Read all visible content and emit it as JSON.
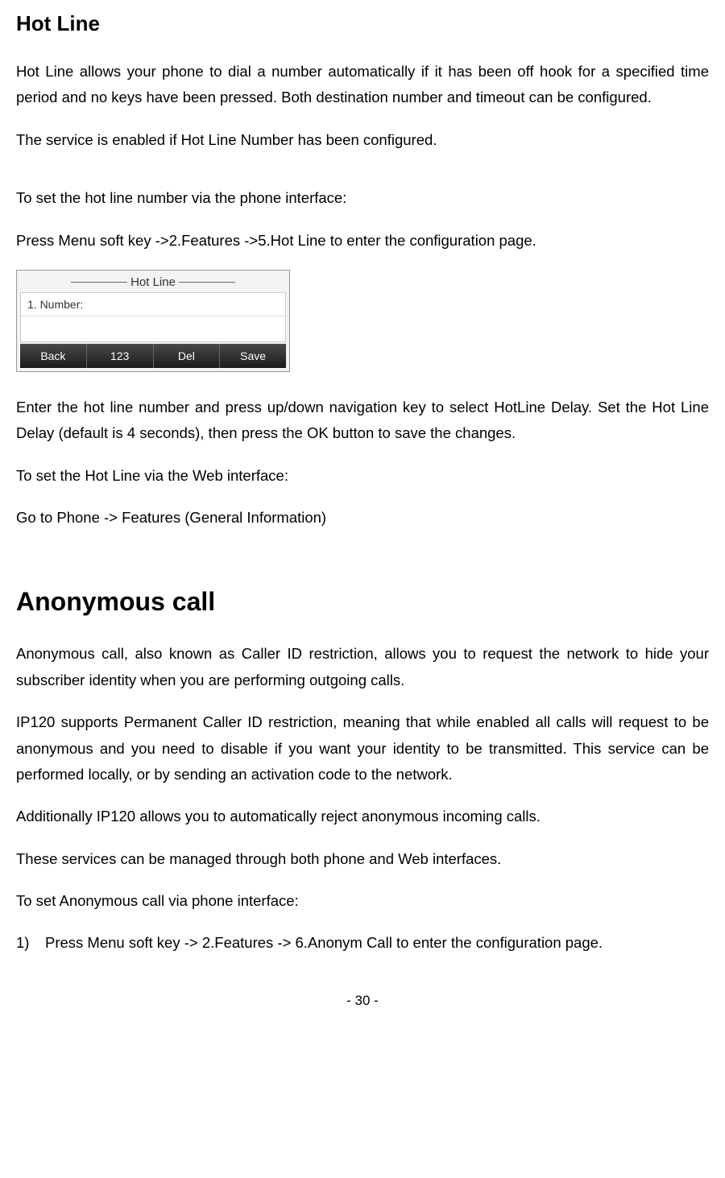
{
  "hotline": {
    "heading": "Hot Line",
    "para1": "Hot Line allows your phone to dial a number automatically if it has been off hook for a specified time period and no keys have been pressed. Both destination number and timeout can be configured.",
    "para2": "The service is enabled if Hot Line Number has been configured.",
    "para3": "To set the hot line number via the phone interface:",
    "para4": "Press Menu soft key ->2.Features ->5.Hot Line to enter the configuration page.",
    "phone_ui": {
      "title": "Hot Line",
      "input_label": "1. Number:",
      "softkeys": [
        "Back",
        "123",
        "Del",
        "Save"
      ]
    },
    "para5": "Enter the hot line number and press up/down navigation key to select HotLine Delay. Set the Hot Line Delay (default is 4 seconds), then press the OK button to save the changes.",
    "para6": "To set the Hot Line via the Web interface:",
    "para7": "Go to Phone -> Features (General Information)"
  },
  "anonymous": {
    "heading": "Anonymous call",
    "para1": "Anonymous call, also known as Caller ID restriction, allows you to request the network to hide your subscriber identity when you are performing outgoing calls.",
    "para2": "IP120 supports Permanent Caller ID restriction, meaning that while enabled all calls will request to be anonymous and you need to disable if you want your identity to be transmitted. This service can be performed locally, or by sending an activation code to the network.",
    "para3": "Additionally IP120 allows you to automatically reject anonymous incoming calls.",
    "para4": "These services can be managed through both phone and Web interfaces.",
    "para5": "To set Anonymous call via phone interface:",
    "list_item1": "Press Menu soft key -> 2.Features -> 6.Anonym Call to enter the configuration page."
  },
  "page_number": "- 30 -"
}
